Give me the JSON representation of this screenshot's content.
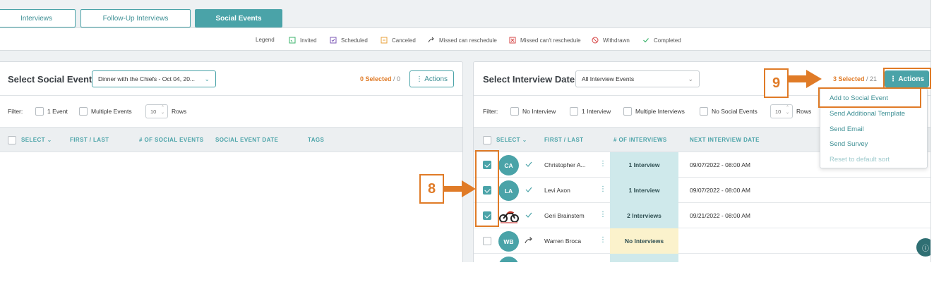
{
  "tabs": [
    {
      "label": "Interviews"
    },
    {
      "label": "Follow-Up Interviews"
    },
    {
      "label": "Social Events"
    }
  ],
  "legend": {
    "title": "Legend",
    "items": [
      {
        "label": "Invited",
        "icon": "invited-icon"
      },
      {
        "label": "Scheduled",
        "icon": "scheduled-icon"
      },
      {
        "label": "Canceled",
        "icon": "canceled-icon"
      },
      {
        "label": "Missed can reschedule",
        "icon": "missed-reschedule-icon"
      },
      {
        "label": "Missed can't reschedule",
        "icon": "missed-no-reschedule-icon"
      },
      {
        "label": "Withdrawn",
        "icon": "withdrawn-icon"
      },
      {
        "label": "Completed",
        "icon": "completed-icon"
      }
    ]
  },
  "left_panel": {
    "title": "Select Social Event:",
    "event_select": "Dinner with the Chiefs - Oct 04, 20...",
    "selected": "0 Selected",
    "total": " / 0",
    "actions_label": "⋮ Actions",
    "filter": {
      "label": "Filter:",
      "options": [
        "1 Event",
        "Multiple Events"
      ],
      "rows_value": "10",
      "rows_label": "Rows"
    },
    "columns": [
      "SELECT ⌄",
      "FIRST / LAST",
      "# OF SOCIAL EVENTS",
      "SOCIAL EVENT DATE",
      "TAGS"
    ]
  },
  "right_panel": {
    "title": "Select Interview Date:",
    "date_select": "All Interview Events",
    "selected": "3 Selected",
    "total": " / 21",
    "actions_label": "⋮ Actions",
    "filter": {
      "label": "Filter:",
      "options": [
        "No Interview",
        "1 Interview",
        "Multiple Interviews",
        "No Social Events"
      ],
      "rows_value": "10",
      "rows_label": "Rows"
    },
    "columns": [
      "SELECT ⌄",
      "FIRST / LAST",
      "# OF INTERVIEWS",
      "NEXT INTERVIEW DATE"
    ],
    "rows": [
      {
        "initials": "CA",
        "name": "Christopher A...",
        "interviews": "1 Interview",
        "date": "09/07/2022 - 08:00 AM",
        "checked": true,
        "status": "completed"
      },
      {
        "initials": "LA",
        "name": "Levi Axon",
        "interviews": "1 Interview",
        "date": "09/07/2022 - 08:00 AM",
        "checked": true,
        "status": "completed"
      },
      {
        "initials": "",
        "name": "Geri Brainstem",
        "interviews": "2 Interviews",
        "date": "09/21/2022 - 08:00 AM",
        "checked": true,
        "status": "completed"
      },
      {
        "initials": "WB",
        "name": "Warren Broca",
        "interviews": "No Interviews",
        "date": "",
        "checked": false,
        "status": "missed-reschedule"
      }
    ]
  },
  "actions_menu": {
    "items": [
      {
        "label": "Add to Social Event",
        "enabled": true
      },
      {
        "label": "Send Additional Template",
        "enabled": true
      },
      {
        "label": "Send Email",
        "enabled": true
      },
      {
        "label": "Send Survey",
        "enabled": true
      },
      {
        "label": "Reset to default sort",
        "enabled": false
      }
    ]
  },
  "annotations": {
    "step_8": "8",
    "step_9": "9"
  },
  "colors": {
    "accent": "#4aa3a8",
    "annotation": "#e07b27",
    "interview_cell": "#cfe9eb",
    "no_interview_cell": "#fbf2cc"
  }
}
